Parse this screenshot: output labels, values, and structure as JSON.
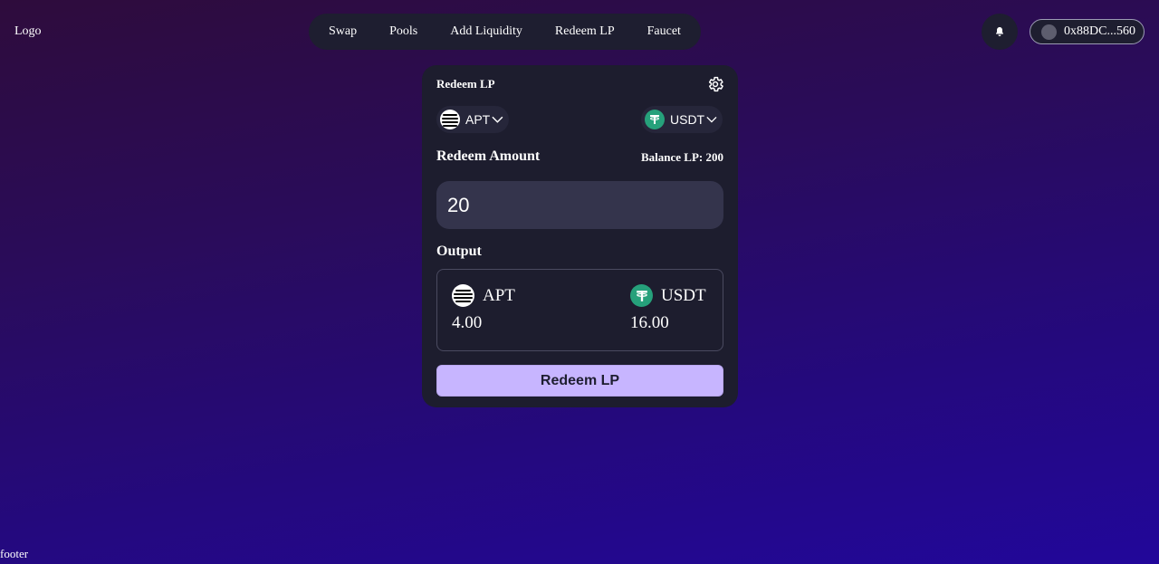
{
  "header": {
    "logo": "Logo",
    "nav": [
      "Swap",
      "Pools",
      "Add Liquidity",
      "Redeem LP",
      "Faucet"
    ],
    "wallet_address": "0x88DC...560"
  },
  "card": {
    "title": "Redeem LP",
    "token_a": "APT",
    "token_b": "USDT",
    "redeem_amount_label": "Redeem Amount",
    "balance_label": "Balance LP: 200",
    "amount_value": "20",
    "output_label": "Output",
    "output": [
      {
        "symbol": "APT",
        "amount": "4.00"
      },
      {
        "symbol": "USDT",
        "amount": "16.00"
      }
    ],
    "button_label": "Redeem LP"
  },
  "footer": {
    "text": "footer"
  },
  "icons": {
    "bell": "bell-icon",
    "gear": "gear-icon",
    "apt": "apt-token-icon",
    "usdt": "usdt-token-icon",
    "chevron": "chevron-down-icon"
  },
  "colors": {
    "accent_button": "#c7b5ff",
    "card_bg": "#1d1d2e",
    "usdt_green": "#26a17b"
  }
}
